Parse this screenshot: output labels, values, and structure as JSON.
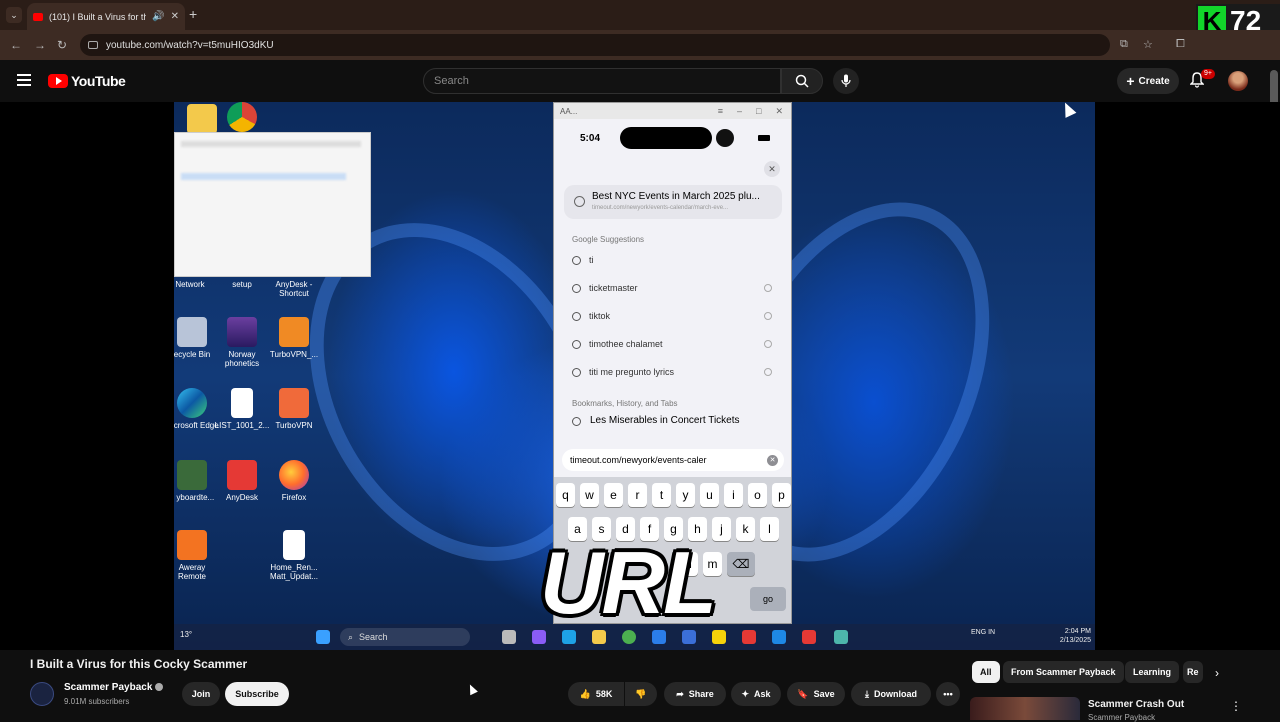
{
  "browser": {
    "tab_title": "(101) I Built a Virus for this",
    "url": "youtube.com/watch?v=t5muHIO3dKU",
    "overlay_badge": {
      "letter": "K",
      "number": "72"
    }
  },
  "youtube_header": {
    "logo_text": "YouTube",
    "search_placeholder": "Search",
    "create_label": "Create",
    "notifications_badge": "9+"
  },
  "desktop": {
    "icons": [
      {
        "label": "Network"
      },
      {
        "label": "setup"
      },
      {
        "label": "AnyDesk - Shortcut"
      },
      {
        "label": "ecycle Bin"
      },
      {
        "label": "Norway phonetics"
      },
      {
        "label": "TurboVPN_..."
      },
      {
        "label": "Microsoft Edge"
      },
      {
        "label": "LIST_1001_2..."
      },
      {
        "label": "TurboVPN"
      },
      {
        "label": "1 yboardte..."
      },
      {
        "label": "AnyDesk"
      },
      {
        "label": "Firefox"
      },
      {
        "label": "Aweray Remote"
      },
      {
        "label": "Home_Ren... Matt_Updat..."
      }
    ],
    "taskbar": {
      "weather": "13°",
      "search_label": "Search",
      "lang": "ENG IN",
      "time": "2:04 PM",
      "date": "2/13/2025"
    }
  },
  "phone": {
    "window_title": "AA...",
    "time": "5:04",
    "top_result": {
      "title": "Best NYC Events in March 2025 plu...",
      "url": "timeout.com/newyork/events-calendar/march-eve..."
    },
    "google_suggestions_label": "Google Suggestions",
    "suggestions": [
      "ti",
      "ticketmaster",
      "tiktok",
      "timothee chalamet",
      "titi me pregunto lyrics"
    ],
    "bookmarks_label": "Bookmarks, History, and Tabs",
    "bookmark_item": "Les Miserables in Concert Tickets",
    "url_field": "timeout.com/newyork/events-caler",
    "keyboard_rows": [
      [
        "q",
        "w",
        "e",
        "r",
        "t",
        "y",
        "u",
        "i",
        "o",
        "p"
      ],
      [
        "a",
        "s",
        "d",
        "f",
        "g",
        "h",
        "j",
        "k",
        "l"
      ],
      [
        "n",
        "m"
      ]
    ],
    "go_key": "go"
  },
  "overlay_caption": "URL",
  "video_info": {
    "title": "I Built a Virus for this Cocky Scammer",
    "channel_name": "Scammer Payback",
    "subscribers": "9.01M subscribers",
    "join_label": "Join",
    "subscribe_label": "Subscribe",
    "likes": "58K",
    "share_label": "Share",
    "ask_label": "Ask",
    "save_label": "Save",
    "download_label": "Download"
  },
  "chips": [
    "All",
    "From Scammer Payback",
    "Learning",
    "Re"
  ],
  "recommendation": {
    "title": "Scammer Crash Out",
    "channel": "Scammer Payback"
  }
}
